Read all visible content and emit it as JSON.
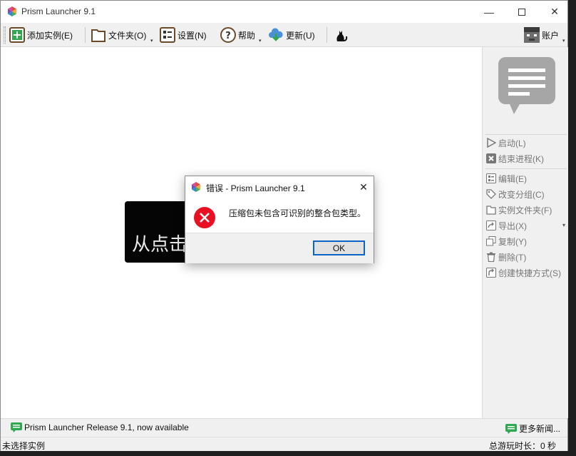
{
  "window": {
    "title": "Prism Launcher 9.1",
    "minimize_glyph": "—",
    "close_glyph": "✕"
  },
  "toolbar": {
    "add_instance": "添加实例(E)",
    "folders": "文件夹(O)",
    "settings": "设置(N)",
    "help": "帮助",
    "update": "更新(U)",
    "accounts": "账户",
    "dropdown_arrow": "▾"
  },
  "main": {
    "hint_text": "从点击"
  },
  "instance_panel": {
    "launch": "启动(L)",
    "kill": "结束进程(K)",
    "edit": "编辑(E)",
    "change_group": "改变分组(C)",
    "instance_folder": "实例文件夹(F)",
    "export": "导出(X)",
    "copy": "复制(Y)",
    "delete": "删除(T)",
    "create_shortcut": "创建快捷方式(S)",
    "more_arrow": "▾"
  },
  "news": {
    "headline": "Prism Launcher Release 9.1, now available",
    "more_news": "更多新闻..."
  },
  "status": {
    "selection": "未选择实例",
    "total_playtime": "总游玩时长：0 秒"
  },
  "dialog": {
    "title": "错误 - Prism Launcher 9.1",
    "message": "压缩包未包含可识别的整合包类型。",
    "ok_label": "OK",
    "close_glyph": "✕"
  },
  "colors": {
    "error_red": "#e81123",
    "accent_blue": "#0a64c8",
    "news_green": "#2fa84f",
    "toolbar_bg": "#f0f0f0"
  }
}
